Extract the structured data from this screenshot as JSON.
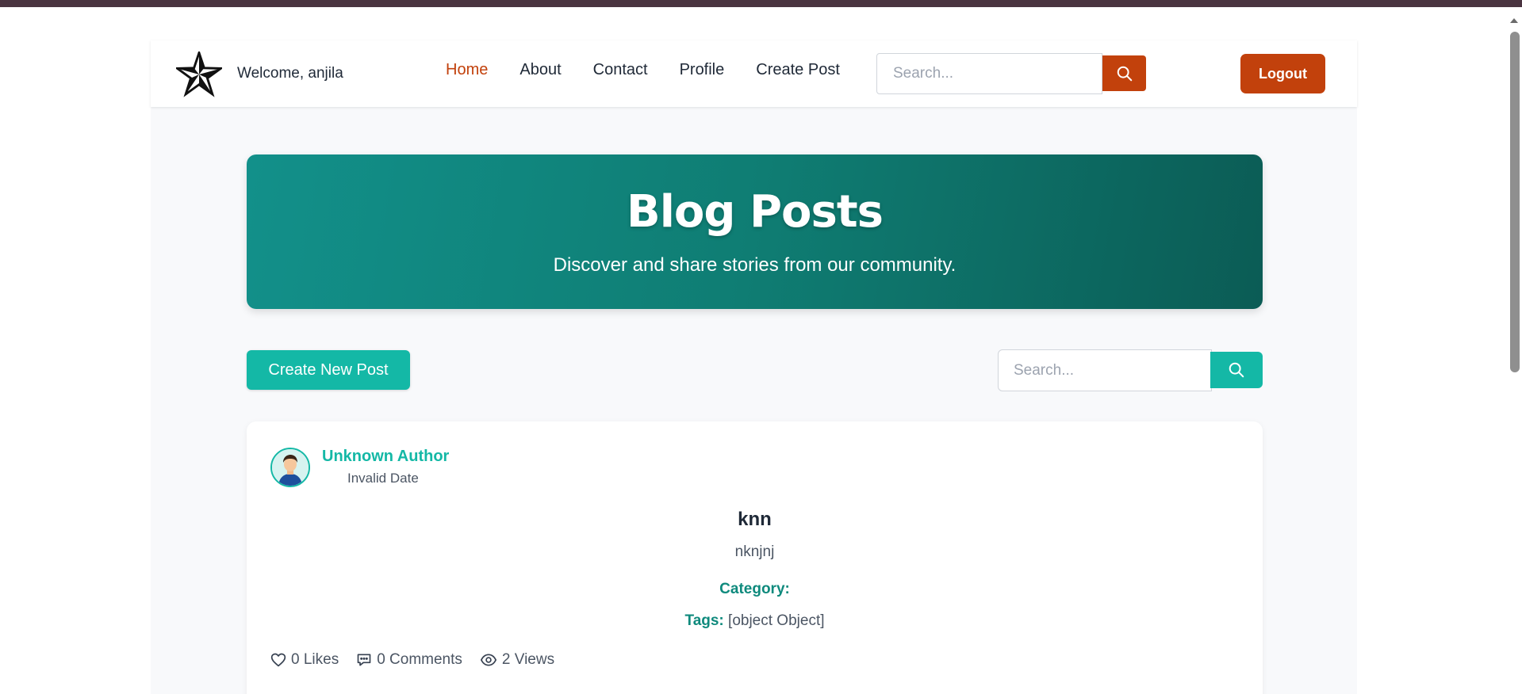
{
  "colors": {
    "accent_orange": "#c2410c",
    "accent_teal": "#14b8a6",
    "hero_gradient_start": "#12908a",
    "hero_gradient_end": "#0b5c55"
  },
  "navbar": {
    "logo_icon": "star-icon",
    "welcome_text": "Welcome, anjila",
    "links": [
      {
        "label": "Home",
        "active": true
      },
      {
        "label": "About",
        "active": false
      },
      {
        "label": "Contact",
        "active": false
      },
      {
        "label": "Profile",
        "active": false
      },
      {
        "label": "Create Post",
        "active": false
      }
    ],
    "search": {
      "placeholder": "Search...",
      "value": "",
      "icon": "search-icon"
    },
    "logout_label": "Logout"
  },
  "hero": {
    "title": "Blog Posts",
    "subtitle": "Discover and share stories from our community."
  },
  "toolbar": {
    "create_label": "Create New Post",
    "search": {
      "placeholder": "Search...",
      "value": "",
      "icon": "search-icon"
    }
  },
  "posts": [
    {
      "author": "Unknown Author",
      "date": "Invalid Date",
      "title": "knn",
      "content": "nknjnj",
      "category_label": "Category:",
      "category_value": "",
      "tags_label": "Tags:",
      "tags_value": "[object Object]",
      "stats": {
        "likes": "0 Likes",
        "comments": "0 Comments",
        "views": "2 Views"
      }
    }
  ]
}
